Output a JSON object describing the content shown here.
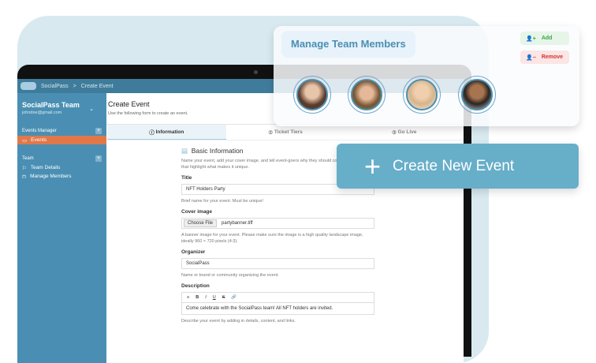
{
  "topbar": {
    "app": "SocialPass",
    "sep": ">",
    "page": "Create Event"
  },
  "sidebar": {
    "team": "SocialPass Team",
    "email": "johndoe@gmail.com",
    "events_manager": "Events Manager",
    "events": "Events",
    "team_section": "Team",
    "team_details": "Team Details",
    "manage_members": "Manage Members"
  },
  "header": {
    "title": "Create Event",
    "subtitle": "Use the following form to create an event."
  },
  "tabs": [
    {
      "num": "1",
      "label": "Information"
    },
    {
      "num": "2",
      "label": "Ticket Tiers"
    },
    {
      "num": "3",
      "label": "Go Live"
    }
  ],
  "form": {
    "section": "Basic Information",
    "section_desc": "Name your event, add your cover image, and tell event-goers why they should come. Add details that highlight what makes it unique.",
    "title_label": "Title",
    "title_value": "NFT Holders Party",
    "title_help": "Brief name for your event. Must be unique!",
    "cover_label": "Cover image",
    "choose_file": "Choose File",
    "file_name": "partybanner.tiff",
    "cover_help": "A banner image for your event. Please make sure the image is a high quality landscape image, ideally 960 × 720 pixels (4:3).",
    "org_label": "Organizer",
    "org_value": "SocialPass",
    "org_help": "Name or brand or community organizing the event.",
    "desc_label": "Description",
    "desc_value": "Come celebrate with the SocialPass team! All NFT holders are invited.",
    "desc_help": "Describe your event by adding in details, content, and links."
  },
  "team_card": {
    "title": "Manage Team Members"
  },
  "actions": {
    "add": "Add",
    "remove": "Remove",
    "create": "Create New Event"
  },
  "colors": {
    "primary": "#4a8fb3",
    "accent": "#e0784a",
    "add": "#3aa64a",
    "remove": "#d9302a",
    "create": "#67aec9"
  }
}
